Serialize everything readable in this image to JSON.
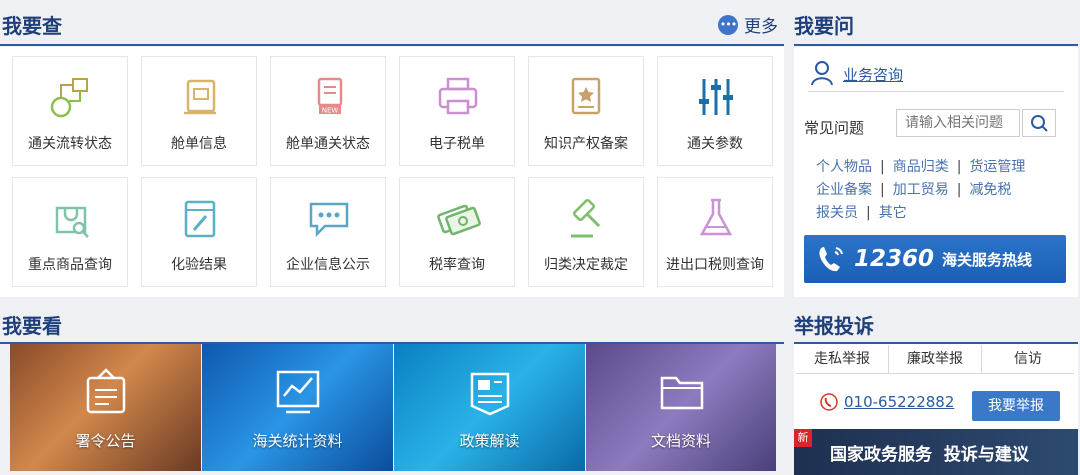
{
  "check": {
    "title": "我要查",
    "more": "更多",
    "tiles": [
      "通关流转状态",
      "舱单信息",
      "舱单通关状态",
      "电子税单",
      "知识产权备案",
      "通关参数",
      "重点商品查询",
      "化验结果",
      "企业信息公示",
      "税率查询",
      "归类决定裁定",
      "进出口税则查询"
    ]
  },
  "ask": {
    "title": "我要问",
    "consult": "业务咨询",
    "faq_label": "常见问题",
    "search_placeholder": "请输入相关问题",
    "tags_row1": [
      "个人物品",
      "商品归类",
      "货运管理"
    ],
    "tags_row2": [
      "企业备案",
      "加工贸易",
      "减免税"
    ],
    "tags_row3": [
      "报关员",
      "其它"
    ],
    "hotline_number": "12360",
    "hotline_text": "海关服务热线"
  },
  "see": {
    "title": "我要看",
    "cards": [
      "署令公告",
      "海关统计资料",
      "政策解读",
      "文档资料"
    ]
  },
  "report": {
    "title": "举报投诉",
    "tabs": [
      "走私举报",
      "廉政举报",
      "信访"
    ],
    "phone": "010-65222882",
    "report_button": "我要举报",
    "badge": "新",
    "banner_text": "国家政务服务  投诉与建议"
  },
  "colors": {
    "accent": "#2c5aa0",
    "title": "#1f3f7a",
    "hotline_bg": "#1b5fb5"
  }
}
